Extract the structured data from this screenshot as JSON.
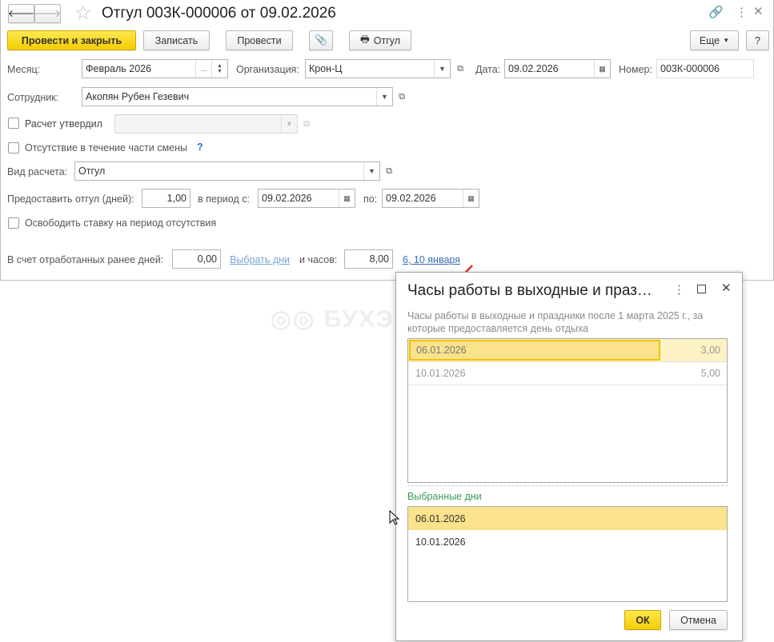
{
  "window": {
    "title": "Отгул 003К-000006 от 09.02.2026"
  },
  "toolbar": {
    "post_close": "Провести и закрыть",
    "save": "Записать",
    "post": "Провести",
    "print": "Отгул",
    "more": "Еще",
    "help": "?"
  },
  "form": {
    "month_label": "Месяц:",
    "month_value": "Февраль 2026",
    "org_label": "Организация:",
    "org_value": "Крон-Ц",
    "date_label": "Дата:",
    "date_value": "09.02.2026",
    "number_label": "Номер:",
    "number_value": "003К-000006",
    "employee_label": "Сотрудник:",
    "employee_value": "Акопян Рубен Гезевич",
    "approved_label": "Расчет утвердил",
    "approved_value": "",
    "partial_label": "Отсутствие в течение части смены",
    "partial_help": "?",
    "calc_type_label": "Вид расчета:",
    "calc_type_value": "Отгул",
    "days_label": "Предоставить отгул (дней):",
    "days_value": "1,00",
    "period_from_label": "в период с:",
    "period_from_value": "09.02.2026",
    "period_to_label": "по:",
    "period_to_value": "09.02.2026",
    "release_label": "Освободить ставку на период отсутствия",
    "worked_days_label": "В счет отработанных ранее дней:",
    "worked_days_value": "0,00",
    "select_days_link": "Выбрать дни",
    "hours_label": "и часов:",
    "hours_value": "8,00",
    "dates_link": "6, 10 января"
  },
  "watermark": "БУХЭКСПЕРТ",
  "dialog": {
    "title": "Часы работы в выходные и праз…",
    "description": "Часы работы в выходные и праздники после 1 марта 2025 г., за которые предоставляется день отдыха",
    "rows": [
      {
        "date": "06.01.2026",
        "hours": "3,00"
      },
      {
        "date": "10.01.2026",
        "hours": "5,00"
      }
    ],
    "selected_label": "Выбранные дни",
    "selected": [
      "06.01.2026",
      "10.01.2026"
    ],
    "ok": "ОК",
    "cancel": "Отмена"
  }
}
